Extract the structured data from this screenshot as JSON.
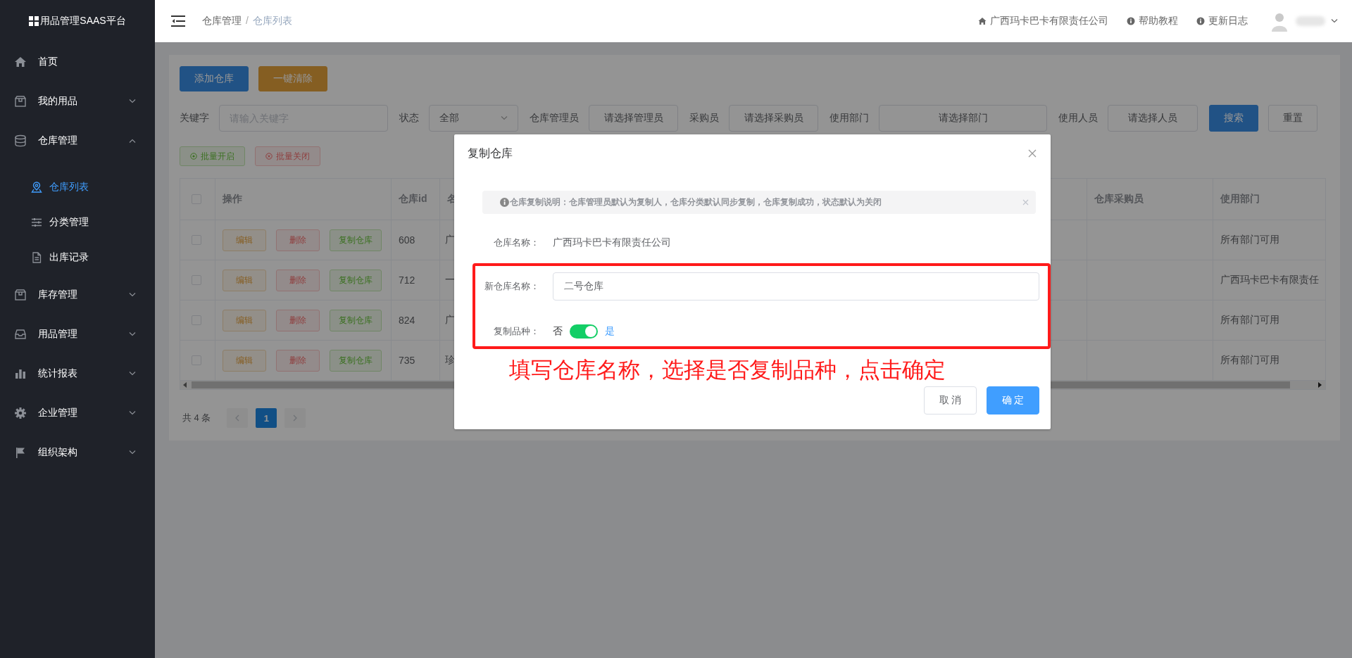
{
  "sidebar": {
    "logo": "用品管理SAAS平台",
    "items": [
      {
        "label": "首页",
        "kind": "link"
      },
      {
        "label": "我的用品",
        "kind": "group",
        "expanded": false
      },
      {
        "label": "仓库管理",
        "kind": "group",
        "expanded": true,
        "children": [
          {
            "label": "仓库列表",
            "selected": true
          },
          {
            "label": "分类管理",
            "selected": false
          },
          {
            "label": "出库记录",
            "selected": false
          }
        ]
      },
      {
        "label": "库存管理",
        "kind": "group",
        "expanded": false
      },
      {
        "label": "用品管理",
        "kind": "group",
        "expanded": false
      },
      {
        "label": "统计报表",
        "kind": "group",
        "expanded": false
      },
      {
        "label": "企业管理",
        "kind": "group",
        "expanded": false
      },
      {
        "label": "组织架构",
        "kind": "group",
        "expanded": false
      }
    ]
  },
  "header": {
    "breadcrumb": [
      "仓库管理",
      "仓库列表"
    ],
    "separator": "/",
    "links": [
      "广西玛卡巴卡有限责任公司",
      "帮助教程",
      "更新日志"
    ]
  },
  "toolbar": {
    "buttons": [
      {
        "label": "添加仓库",
        "kind": "primary"
      },
      {
        "label": "一键清除",
        "kind": "warning"
      }
    ]
  },
  "filters": [
    {
      "label": "关键字",
      "kind": "input",
      "placeholder": "请输入关键字"
    },
    {
      "label": "状态",
      "kind": "select",
      "value": "全部"
    },
    {
      "label": "仓库管理员",
      "kind": "picker",
      "text": "请选择管理员"
    },
    {
      "label": "采购员",
      "kind": "picker",
      "text": "请选择采购员"
    },
    {
      "label": "使用部门",
      "kind": "picker",
      "text": "请选择部门"
    },
    {
      "label": "使用人员",
      "kind": "picker",
      "text": "请选择人员"
    }
  ],
  "filter_buttons": [
    {
      "label": "搜索",
      "kind": "primary"
    },
    {
      "label": "重置",
      "kind": "default"
    }
  ],
  "batch_buttons": [
    {
      "label": "批量开启",
      "kind": "success"
    },
    {
      "label": "批量关闭",
      "kind": "danger"
    }
  ],
  "table": {
    "all_checked": false,
    "columns": [
      "操作",
      "仓库id",
      "名",
      "仓库采购员",
      "使用部门"
    ],
    "rows": [
      {
        "checked": false,
        "actions": [
          {
            "label": "编辑",
            "kind": "edit"
          },
          {
            "label": "删除",
            "kind": "delete"
          },
          {
            "label": "复制仓库",
            "kind": "copy"
          }
        ],
        "id": "608",
        "name": "广",
        "department": "所有部门可用"
      },
      {
        "checked": false,
        "actions": [
          {
            "label": "编辑",
            "kind": "edit"
          },
          {
            "label": "删除",
            "kind": "delete"
          },
          {
            "label": "复制仓库",
            "kind": "copy"
          }
        ],
        "id": "712",
        "name": "一",
        "department": "广西玛卡巴卡有限责任"
      },
      {
        "checked": false,
        "actions": [
          {
            "label": "编辑",
            "kind": "edit"
          },
          {
            "label": "删除",
            "kind": "delete"
          },
          {
            "label": "复制仓库",
            "kind": "copy"
          }
        ],
        "id": "824",
        "name": "广",
        "department": "所有部门可用"
      },
      {
        "checked": false,
        "actions": [
          {
            "label": "编辑",
            "kind": "edit"
          },
          {
            "label": "删除",
            "kind": "delete"
          },
          {
            "label": "复制仓库",
            "kind": "copy"
          }
        ],
        "id": "735",
        "name": "珍",
        "department": "所有部门可用"
      }
    ]
  },
  "pagination": {
    "total": "共 4 条",
    "pages": [
      {
        "label": "1",
        "selected": true
      }
    ]
  },
  "modal": {
    "title": "复制仓库",
    "notice": "仓库复制说明：仓库管理员默认为复制人，仓库分类默认同步复制，仓库复制成功，状态默认为关闭",
    "fields": [
      {
        "kind": "text",
        "label": "仓库名称：",
        "value": "广西玛卡巴卡有限责任公司"
      },
      {
        "kind": "input",
        "label": "新仓库名称：",
        "value": "二号仓库"
      },
      {
        "kind": "switch",
        "label": "复制品种：",
        "off_label": "否",
        "on_label": "是",
        "on": true
      }
    ],
    "annotation": "填写仓库名称，选择是否复制品种，点击确定",
    "buttons": [
      {
        "label": "取 消",
        "kind": "default"
      },
      {
        "label": "确 定",
        "kind": "primary"
      }
    ]
  }
}
